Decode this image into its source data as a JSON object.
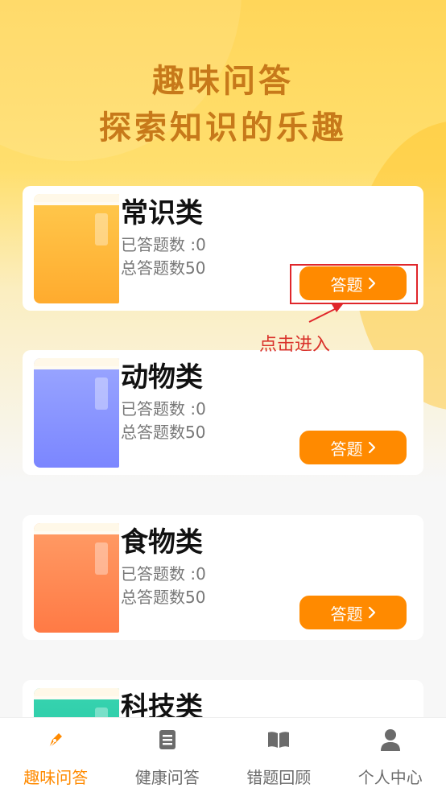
{
  "header": {
    "title_line1": "趣味问答",
    "title_line2": "探索知识的乐趣"
  },
  "categories": [
    {
      "title": "常识类",
      "answered": "已答题数 :0",
      "total": "总答题数50",
      "button_label": "答题",
      "color_top": "#ffc94d",
      "color_bottom": "#ffab2e"
    },
    {
      "title": "动物类",
      "answered": "已答题数 :0",
      "total": "总答题数50",
      "button_label": "答题",
      "color_top": "#9aa6ff",
      "color_bottom": "#7b86ff"
    },
    {
      "title": "食物类",
      "answered": "已答题数 :0",
      "total": "总答题数50",
      "button_label": "答题",
      "color_top": "#ff9c66",
      "color_bottom": "#ff7a45"
    },
    {
      "title": "科技类",
      "answered": "",
      "total": "",
      "button_label": "",
      "color_top": "#38d4b0",
      "color_bottom": "#1fc29f"
    }
  ],
  "annotation": {
    "hint": "点击进入",
    "highlight_color": "#e0262b"
  },
  "tabbar": {
    "items": [
      {
        "label": "趣味问答",
        "icon": "pen-nib-icon",
        "active": true
      },
      {
        "label": "健康问答",
        "icon": "list-document-icon",
        "active": false
      },
      {
        "label": "错题回顾",
        "icon": "open-book-icon",
        "active": false
      },
      {
        "label": "个人中心",
        "icon": "person-icon",
        "active": false
      }
    ],
    "active_color": "#ff8a00",
    "inactive_color": "#6b6b6b"
  }
}
